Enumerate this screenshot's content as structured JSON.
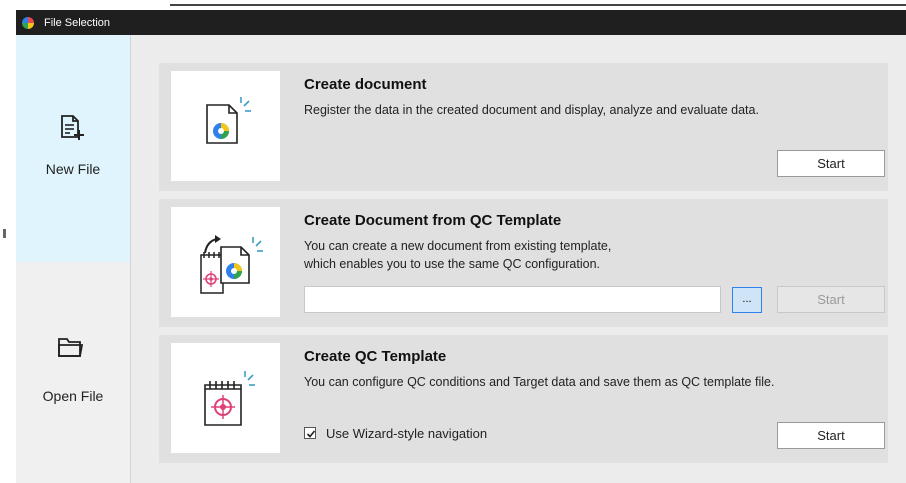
{
  "window": {
    "title": "File Selection"
  },
  "sidebar": {
    "items": [
      {
        "label": "New File",
        "icon": "new-file-icon",
        "selected": true
      },
      {
        "label": "Open File",
        "icon": "folder-icon",
        "selected": false
      }
    ]
  },
  "cards": {
    "create_document": {
      "title": "Create document",
      "description": "Register the data in the created document and display, analyze and evaluate data.",
      "start_label": "Start"
    },
    "from_template": {
      "title": "Create Document from QC Template",
      "description_line1": "You can create a new document from existing template,",
      "description_line2": "which enables you to use the same QC configuration.",
      "path_value": "",
      "browse_label": "...",
      "start_label": "Start",
      "start_enabled": false
    },
    "create_template": {
      "title": "Create QC Template",
      "description": "You can configure QC conditions and Target data and save them as QC template file.",
      "wizard_label": "Use Wizard-style navigation",
      "wizard_checked": true,
      "start_label": "Start"
    }
  },
  "colors": {
    "selected_nav": "#dff4fd",
    "titlebar": "#1f1f1f",
    "card": "#e0e0e0",
    "accent_blue": "#2f80ed",
    "accent_pink": "#e0407a"
  }
}
